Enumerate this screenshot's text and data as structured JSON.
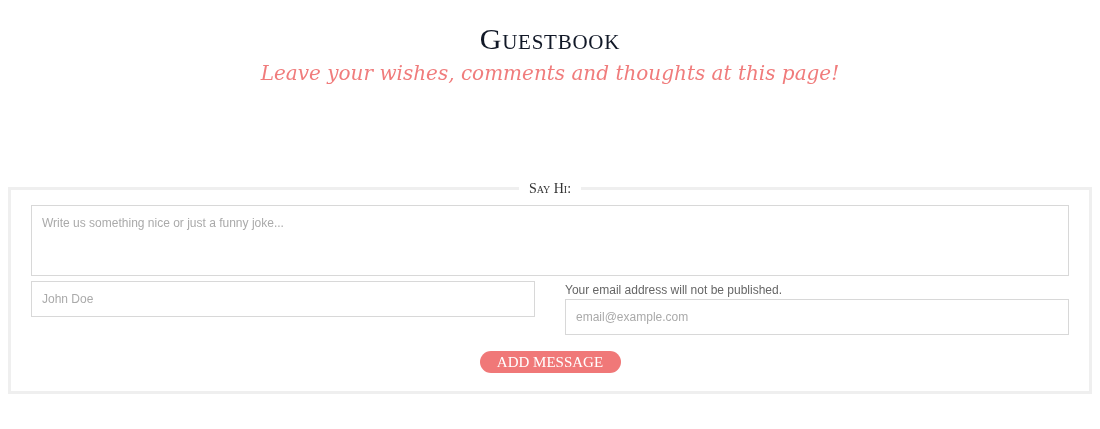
{
  "header": {
    "title": "Guestbook",
    "subtitle": "Leave your wishes, comments and thoughts at this page!"
  },
  "form": {
    "legend": "Say Hi:",
    "message": {
      "placeholder": "Write us something nice or just a funny joke..."
    },
    "name": {
      "placeholder": "John Doe"
    },
    "email_note": "Your email address will not be published.",
    "email": {
      "placeholder": "email@example.com"
    },
    "submit": "ADD MESSAGE"
  }
}
